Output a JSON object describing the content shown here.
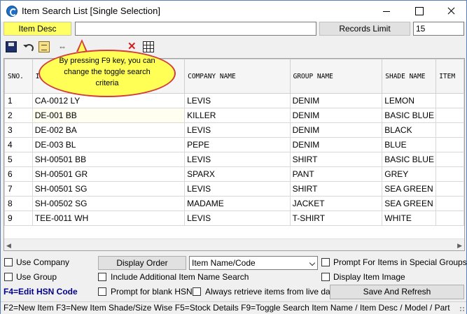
{
  "window": {
    "title": "Item Search List [Single Selection]"
  },
  "search": {
    "mode_label": "Item Desc",
    "query_value": "",
    "records_limit_label": "Records Limit",
    "records_limit_value": "15"
  },
  "toolbar": {
    "icons": [
      "save-icon",
      "undo-icon",
      "notepad-icon",
      "swap-arrows-icon",
      "delete-x-icon",
      "grid-icon"
    ]
  },
  "tooltip": {
    "text": "By pressing F9 key, you can change the toggle search criteria"
  },
  "grid": {
    "columns": [
      "SNO.",
      "I",
      "COMPANY NAME",
      "GROUP NAME",
      "SHADE NAME",
      "ITEM"
    ],
    "rows": [
      {
        "sno": "1",
        "item": "CA-0012 LY",
        "company": "LEVIS",
        "group": "DENIM",
        "shade": "LEMON"
      },
      {
        "sno": "2",
        "item": "DE-001 BB",
        "company": "KILLER",
        "group": "DENIM",
        "shade": "BASIC BLUE"
      },
      {
        "sno": "3",
        "item": "DE-002 BA",
        "company": "LEVIS",
        "group": "DENIM",
        "shade": "BLACK"
      },
      {
        "sno": "4",
        "item": "DE-003 BL",
        "company": "PEPE",
        "group": "DENIM",
        "shade": "BLUE"
      },
      {
        "sno": "5",
        "item": "SH-00501 BB",
        "company": "LEVIS",
        "group": "SHIRT",
        "shade": "BASIC BLUE"
      },
      {
        "sno": "6",
        "item": "SH-00501 GR",
        "company": "SPARX",
        "group": "PANT",
        "shade": "GREY"
      },
      {
        "sno": "7",
        "item": "SH-00501 SG",
        "company": "LEVIS",
        "group": "SHIRT",
        "shade": "SEA GREEN"
      },
      {
        "sno": "8",
        "item": "SH-00502 SG",
        "company": "MADAME",
        "group": "JACKET",
        "shade": "SEA GREEN"
      },
      {
        "sno": "9",
        "item": "TEE-0011 WH",
        "company": "LEVIS",
        "group": "T-SHIRT",
        "shade": "WHITE"
      }
    ]
  },
  "options": {
    "use_company": "Use Company",
    "use_group": "Use Group",
    "display_order_label": "Display Order",
    "display_order_value": "Item Name/Code",
    "include_additional": "Include Additional Item Name Search",
    "prompt_blank_hsn": "Prompt for blank HSN",
    "always_live": "Always retrieve items from live data",
    "prompt_special_groups": "Prompt For Items in Special Groups",
    "display_item_image": "Display Item Image",
    "save_refresh": "Save And Refresh",
    "edit_hsn": "F4=Edit HSN Code"
  },
  "statusbar": {
    "text": "F2=New Item   F3=New Item Shade/Size Wise   F5=Stock Details   F9=Toggle Search Item Name / Item Desc / Model / Part"
  },
  "colors": {
    "mode_label_bg": "#ffff66",
    "tooltip_bg": "#ffff55",
    "tooltip_border": "#d43c3c",
    "hsn_link": "#00008b"
  }
}
